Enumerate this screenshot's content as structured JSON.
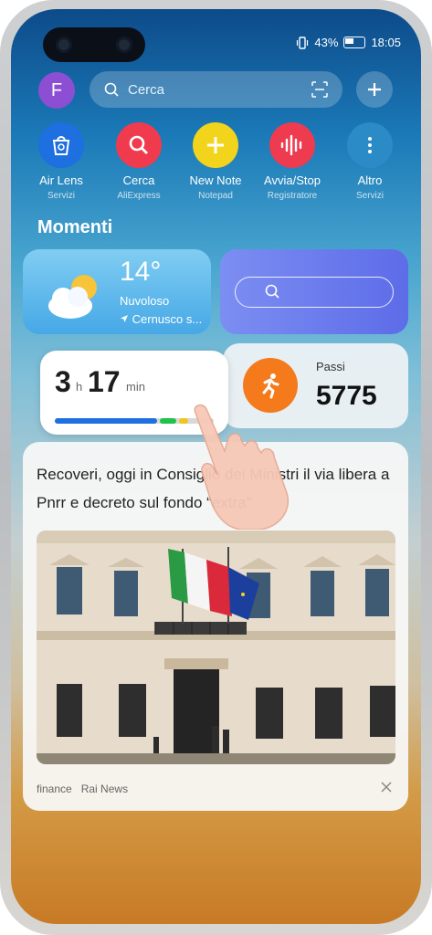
{
  "status": {
    "battery": "43%",
    "time": "18:05"
  },
  "header": {
    "avatar_letter": "F",
    "search_placeholder": "Cerca"
  },
  "apps": [
    {
      "label": "Air Lens",
      "sub": "Servizi",
      "color": "#1e6fe0"
    },
    {
      "label": "Cerca",
      "sub": "AliExpress",
      "color": "#ef3b4d"
    },
    {
      "label": "New Note",
      "sub": "Notepad",
      "color": "#f3d41c"
    },
    {
      "label": "Avvia/Stop",
      "sub": "Registratore",
      "color": "#ee3b4f"
    },
    {
      "label": "Altro",
      "sub": "Servizi",
      "color": "#2a8bc6"
    }
  ],
  "section_title": "Momenti",
  "weather": {
    "temp": "14°",
    "desc": "Nuvoloso",
    "location": "Cernusco s..."
  },
  "timer": {
    "hours": "3",
    "h_unit": "h",
    "minutes": "17",
    "min_unit": "min"
  },
  "steps": {
    "label": "Passi",
    "value": "5775"
  },
  "news": {
    "headline": "Recoveri, oggi in Consiglio dei Ministri il via libera a Pnrr e decreto sul fondo “extra”",
    "source_category": "finance",
    "source_name": "Rai News"
  },
  "colors": {
    "steps_accent": "#f47a1c",
    "timer_bar": "#1e6fe0",
    "timer_bar_green": "#20c24a"
  }
}
